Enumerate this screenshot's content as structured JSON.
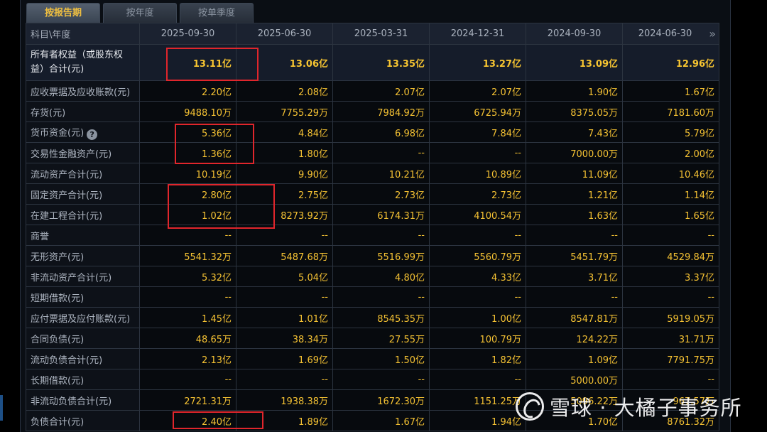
{
  "tabs": [
    {
      "label": "按报告期",
      "active": true
    },
    {
      "label": "按年度",
      "active": false
    },
    {
      "label": "按单季度",
      "active": false
    }
  ],
  "header": {
    "label": "科目\\年度",
    "periods": [
      "2025-09-30",
      "2025-06-30",
      "2025-03-31",
      "2024-12-31",
      "2024-09-30",
      "2024-06-30"
    ]
  },
  "rows": [
    {
      "label": "所有者权益（或股东权益）合计(元)",
      "strong": true,
      "values": [
        "13.11亿",
        "13.06亿",
        "13.35亿",
        "13.27亿",
        "13.09亿",
        "12.96亿"
      ]
    },
    {
      "label": "应收票据及应收账款(元)",
      "values": [
        "2.20亿",
        "2.08亿",
        "2.07亿",
        "2.07亿",
        "1.90亿",
        "1.67亿"
      ]
    },
    {
      "label": "存货(元)",
      "values": [
        "9488.10万",
        "7755.29万",
        "7984.92万",
        "6725.94万",
        "8375.05万",
        "7181.60万"
      ]
    },
    {
      "label": "货币资金(元)",
      "help": true,
      "values": [
        "5.36亿",
        "4.84亿",
        "6.98亿",
        "7.84亿",
        "7.43亿",
        "5.79亿"
      ]
    },
    {
      "label": "交易性金融资产(元)",
      "values": [
        "1.36亿",
        "1.80亿",
        "--",
        "--",
        "7000.00万",
        "2.00亿"
      ]
    },
    {
      "label": "流动资产合计(元)",
      "values": [
        "10.19亿",
        "9.90亿",
        "10.21亿",
        "10.89亿",
        "11.09亿",
        "10.46亿"
      ]
    },
    {
      "label": "固定资产合计(元)",
      "values": [
        "2.80亿",
        "2.75亿",
        "2.73亿",
        "2.73亿",
        "1.21亿",
        "1.14亿"
      ]
    },
    {
      "label": "在建工程合计(元)",
      "values": [
        "1.02亿",
        "8273.92万",
        "6174.31万",
        "4100.54万",
        "1.63亿",
        "1.65亿"
      ]
    },
    {
      "label": "商誉",
      "values": [
        "--",
        "--",
        "--",
        "--",
        "--",
        "--"
      ]
    },
    {
      "label": "无形资产(元)",
      "values": [
        "5541.32万",
        "5487.68万",
        "5516.99万",
        "5560.79万",
        "5451.79万",
        "4529.84万"
      ]
    },
    {
      "label": "非流动资产合计(元)",
      "values": [
        "5.32亿",
        "5.04亿",
        "4.80亿",
        "4.33亿",
        "3.71亿",
        "3.37亿"
      ]
    },
    {
      "label": "短期借款(元)",
      "values": [
        "--",
        "--",
        "--",
        "--",
        "--",
        "--"
      ]
    },
    {
      "label": "应付票据及应付账款(元)",
      "values": [
        "1.45亿",
        "1.01亿",
        "8545.35万",
        "1.00亿",
        "8547.81万",
        "5919.05万"
      ]
    },
    {
      "label": "合同负债(元)",
      "values": [
        "48.65万",
        "38.34万",
        "27.55万",
        "100.79万",
        "124.22万",
        "31.71万"
      ]
    },
    {
      "label": "流动负债合计(元)",
      "values": [
        "2.13亿",
        "1.69亿",
        "1.50亿",
        "1.82亿",
        "1.09亿",
        "7791.75万"
      ]
    },
    {
      "label": "长期借款(元)",
      "values": [
        "--",
        "--",
        "--",
        "--",
        "5000.00万",
        "--"
      ]
    },
    {
      "label": "非流动负债合计(元)",
      "values": [
        "2721.31万",
        "1938.38万",
        "1672.30万",
        "1151.25万",
        "5096.22万",
        "967.57万"
      ]
    },
    {
      "label": "负债合计(元)",
      "values": [
        "2.40亿",
        "1.89亿",
        "1.67亿",
        "1.94亿",
        "1.70亿",
        "8761.32万"
      ]
    }
  ],
  "watermark": "雪球 · 大橘子事务所",
  "colors": {
    "value": "#f5c233",
    "highlight": "#e0262c",
    "header_bg": "#1b2230"
  }
}
